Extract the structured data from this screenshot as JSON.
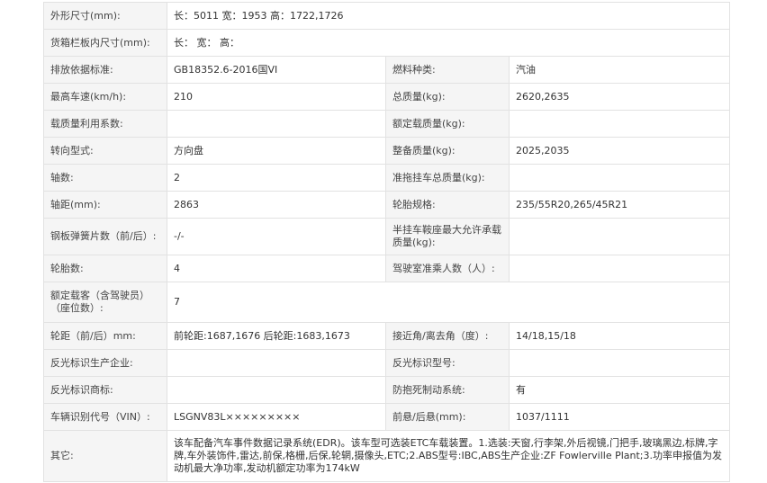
{
  "rows": [
    {
      "cells": [
        {
          "label": "外形尺寸(mm):",
          "value": "长：5011 宽：1953 高：1722,1726",
          "span": true
        }
      ]
    },
    {
      "cells": [
        {
          "label": "货箱栏板内尺寸(mm):",
          "value": "长：  宽：  高：",
          "span": true
        }
      ]
    },
    {
      "cells": [
        {
          "label": "排放依据标准:",
          "value": "GB18352.6-2016国VI"
        },
        {
          "label": "燃料种类:",
          "value": "汽油"
        }
      ]
    },
    {
      "cells": [
        {
          "label": "最高车速(km/h):",
          "value": "210"
        },
        {
          "label": "总质量(kg):",
          "value": "2620,2635"
        }
      ]
    },
    {
      "cells": [
        {
          "label": "载质量利用系数:",
          "value": ""
        },
        {
          "label": "额定载质量(kg):",
          "value": ""
        }
      ]
    },
    {
      "cells": [
        {
          "label": "转向型式:",
          "value": "方向盘"
        },
        {
          "label": "整备质量(kg):",
          "value": "2025,2035"
        }
      ]
    },
    {
      "cells": [
        {
          "label": "轴数:",
          "value": "2"
        },
        {
          "label": "准拖挂车总质量(kg):",
          "value": ""
        }
      ]
    },
    {
      "cells": [
        {
          "label": "轴距(mm):",
          "value": "2863"
        },
        {
          "label": "轮胎规格:",
          "value": "235/55R20,265/45R21"
        }
      ]
    },
    {
      "cells": [
        {
          "label": "钢板弹簧片数（前/后）:",
          "value": "-/-"
        },
        {
          "label": "半挂车鞍座最大允许承载质量(kg):",
          "value": ""
        }
      ]
    },
    {
      "cells": [
        {
          "label": "轮胎数:",
          "value": "4"
        },
        {
          "label": "驾驶室准乘人数（人）:",
          "value": ""
        }
      ]
    },
    {
      "cells": [
        {
          "label": "额定载客（含驾驶员）（座位数）:",
          "value": "7",
          "span": true
        }
      ]
    },
    {
      "cells": [
        {
          "label": "轮距（前/后）mm:",
          "value": "前轮距:1687,1676 后轮距:1683,1673"
        },
        {
          "label": "接近角/离去角（度）:",
          "value": "14/18,15/18"
        }
      ]
    },
    {
      "cells": [
        {
          "label": "反光标识生产企业:",
          "value": ""
        },
        {
          "label": "反光标识型号:",
          "value": ""
        }
      ]
    },
    {
      "cells": [
        {
          "label": "反光标识商标:",
          "value": ""
        },
        {
          "label": "防抱死制动系统:",
          "value": "有"
        }
      ]
    },
    {
      "cells": [
        {
          "label": "车辆识别代号（VIN）:",
          "value": "LSGNV83L×××××××××"
        },
        {
          "label": "前悬/后悬(mm):",
          "value": "1037/1111"
        }
      ]
    },
    {
      "cells": [
        {
          "label": "其它:",
          "value": "该车配备汽车事件数据记录系统(EDR)。该车型可选装ETC车载装置。1.选装:天窗,行李架,外后视镜,门把手,玻璃黑边,标牌,字牌,车外装饰件,雷达,前保,格栅,后保,轮辋,摄像头,ETC;2.ABS型号:IBC,ABS生产企业:ZF Fowlerville Plant;3.功率申报值为发动机最大净功率,发动机额定功率为174kW",
          "span": true
        }
      ]
    }
  ]
}
